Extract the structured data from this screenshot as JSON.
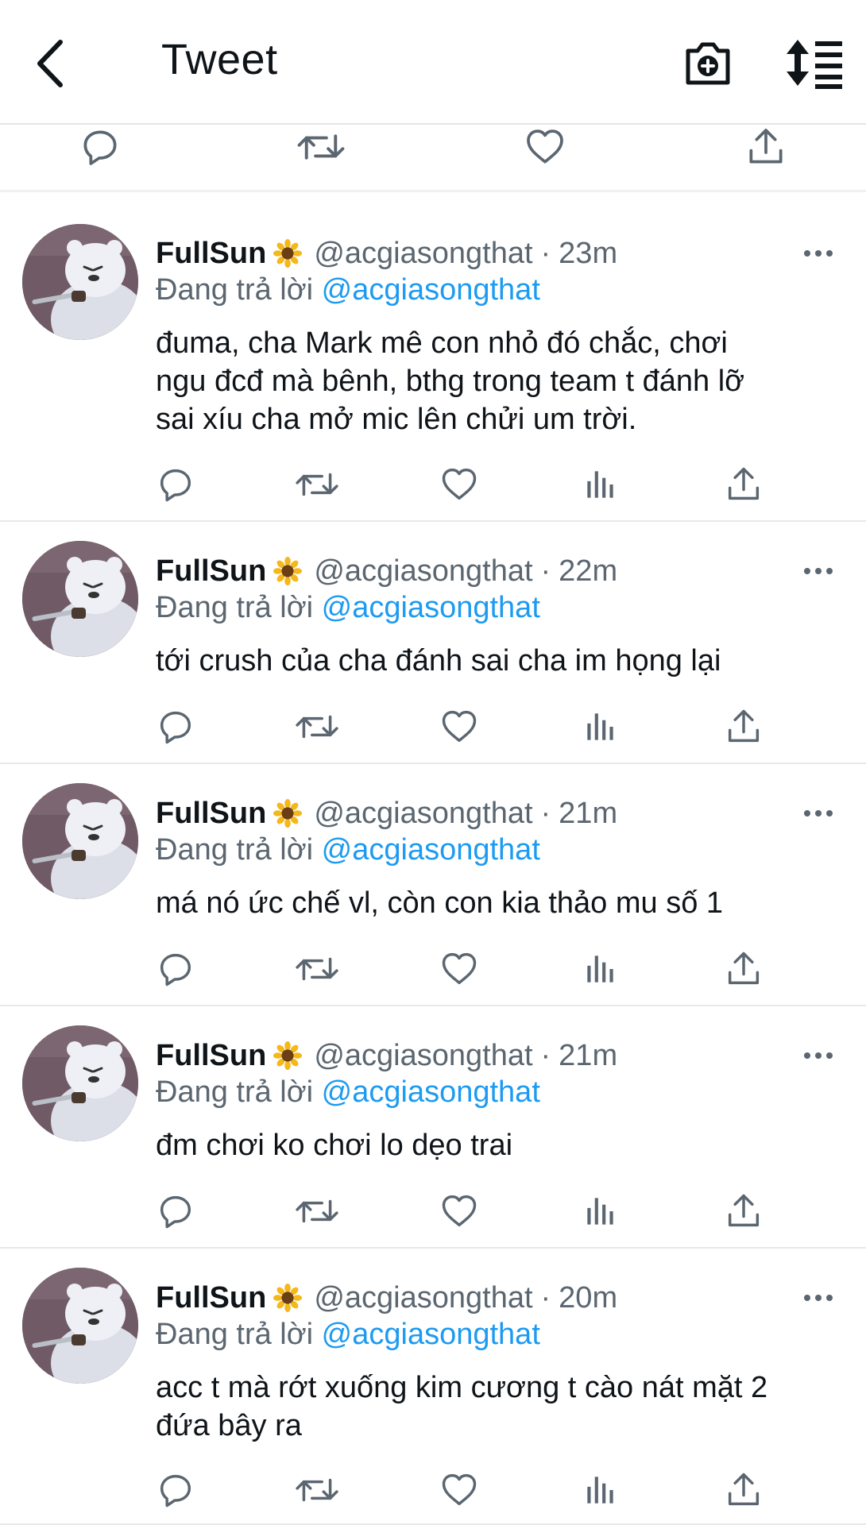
{
  "header": {
    "title": "Tweet",
    "back_icon": "chevron-left-icon",
    "camera_icon": "camera-add-icon",
    "sort_icon": "sort-icon"
  },
  "colors": {
    "link": "#1d9bf0",
    "secondary": "#5b6670",
    "text": "#0f1419",
    "divider": "#e6e9ec"
  },
  "tweets": [
    {
      "name": "FullSun",
      "emoji_icon": "sunflower-icon",
      "handle": "@acgiasongthat",
      "separator": "·",
      "time": "23m",
      "reply_prefix": "Đang trả lời",
      "reply_to": "@acgiasongthat",
      "lines": [
        "đuma, cha Mark mê con nhỏ đó chắc, chơi",
        "ngu đcđ mà bênh, bthg trong team t đánh lỡ",
        "sai xíu cha mở mic lên chửi um trời."
      ]
    },
    {
      "name": "FullSun",
      "emoji_icon": "sunflower-icon",
      "handle": "@acgiasongthat",
      "separator": "·",
      "time": "22m",
      "reply_prefix": "Đang trả lời",
      "reply_to": "@acgiasongthat",
      "lines": [
        "tới crush của cha đánh sai cha im họng lại"
      ]
    },
    {
      "name": "FullSun",
      "emoji_icon": "sunflower-icon",
      "handle": "@acgiasongthat",
      "separator": "·",
      "time": "21m",
      "reply_prefix": "Đang trả lời",
      "reply_to": "@acgiasongthat",
      "lines": [
        "má nó ức chế vl, còn con kia thảo mu số 1"
      ]
    },
    {
      "name": "FullSun",
      "emoji_icon": "sunflower-icon",
      "handle": "@acgiasongthat",
      "separator": "·",
      "time": "21m",
      "reply_prefix": "Đang trả lời",
      "reply_to": "@acgiasongthat",
      "lines": [
        "đm chơi ko chơi lo dẹo trai"
      ]
    },
    {
      "name": "FullSun",
      "emoji_icon": "sunflower-icon",
      "handle": "@acgiasongthat",
      "separator": "·",
      "time": "20m",
      "reply_prefix": "Đang trả lời",
      "reply_to": "@acgiasongthat",
      "lines": [
        "acc t mà rớt xuống kim cương t cào nát mặt 2",
        "đứa bây ra"
      ]
    }
  ]
}
